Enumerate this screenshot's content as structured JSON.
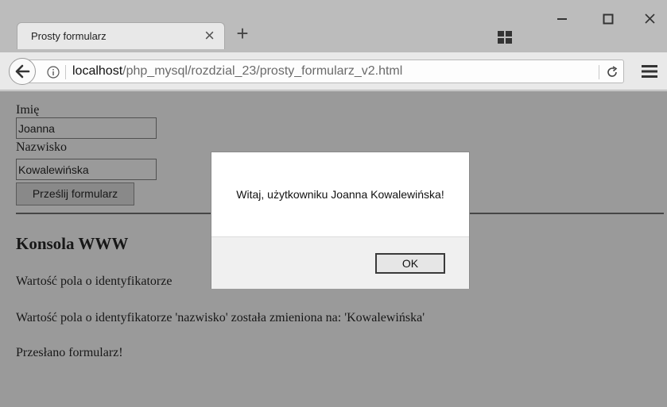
{
  "browser": {
    "tab_title": "Prosty formularz",
    "tab_close_glyph": "×",
    "new_tab_glyph": "+",
    "url_host": "localhost",
    "url_path": "/php_mysql/rozdzial_23/prosty_formularz_v2.html"
  },
  "icons": {
    "back": "back-arrow-icon",
    "info": "info-icon",
    "reload": "reload-icon",
    "menu": "hamburger-menu-icon",
    "tiles": "tab-tiles-icon",
    "minimize": "minimize-icon",
    "maximize": "maximize-icon",
    "close": "close-icon"
  },
  "form": {
    "first_name_label": "Imię",
    "first_name_value": "Joanna",
    "last_name_label": "Nazwisko",
    "last_name_value": "Kowalewińska",
    "submit_label": "Prześlij formularz"
  },
  "console": {
    "heading": "Konsola WWW",
    "lines": [
      "Wartość pola o identyfikatorze",
      "Wartość pola o identyfikatorze 'nazwisko' została zmieniona na: 'Kowalewińska'",
      "Przesłano formularz!"
    ]
  },
  "dialog": {
    "message": "Witaj, użytkowniku Joanna Kowalewińska!",
    "ok_label": "OK"
  }
}
